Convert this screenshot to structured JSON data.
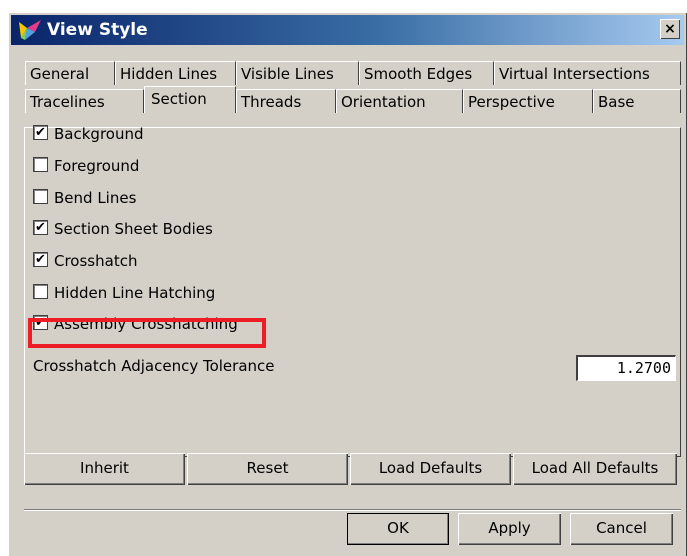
{
  "window": {
    "title": "View Style",
    "close_glyph": "×",
    "app_icon": "view-style-app-icon"
  },
  "tabs": {
    "row1": [
      "General",
      "Hidden Lines",
      "Visible Lines",
      "Smooth Edges",
      "Virtual Intersections"
    ],
    "row2": [
      "Tracelines",
      "Section",
      "Threads",
      "Orientation",
      "Perspective",
      "Base"
    ],
    "active": "Section"
  },
  "section": {
    "options": [
      {
        "label": "Background",
        "checked": true
      },
      {
        "label": "Foreground",
        "checked": false
      },
      {
        "label": "Bend Lines",
        "checked": false
      },
      {
        "label": "Section Sheet Bodies",
        "checked": true
      },
      {
        "label": "Crosshatch",
        "checked": true
      },
      {
        "label": "Hidden Line Hatching",
        "checked": false
      },
      {
        "label": "Assembly Crosshatching",
        "checked": true
      }
    ],
    "highlighted_option": "Assembly Crosshatching",
    "highlight_color": "#ee1c24",
    "tolerance_label": "Crosshatch Adjacency Tolerance",
    "tolerance_value": "1.2700"
  },
  "actions": {
    "inherit": "Inherit",
    "reset": "Reset",
    "load_defaults": "Load Defaults",
    "load_all_defaults": "Load All Defaults"
  },
  "dialog_buttons": {
    "ok": "OK",
    "apply": "Apply",
    "cancel": "Cancel"
  },
  "colors": {
    "dialog_bg": "#d4d0c8",
    "titlebar_start": "#0a246a",
    "titlebar_end": "#a6caf0"
  }
}
